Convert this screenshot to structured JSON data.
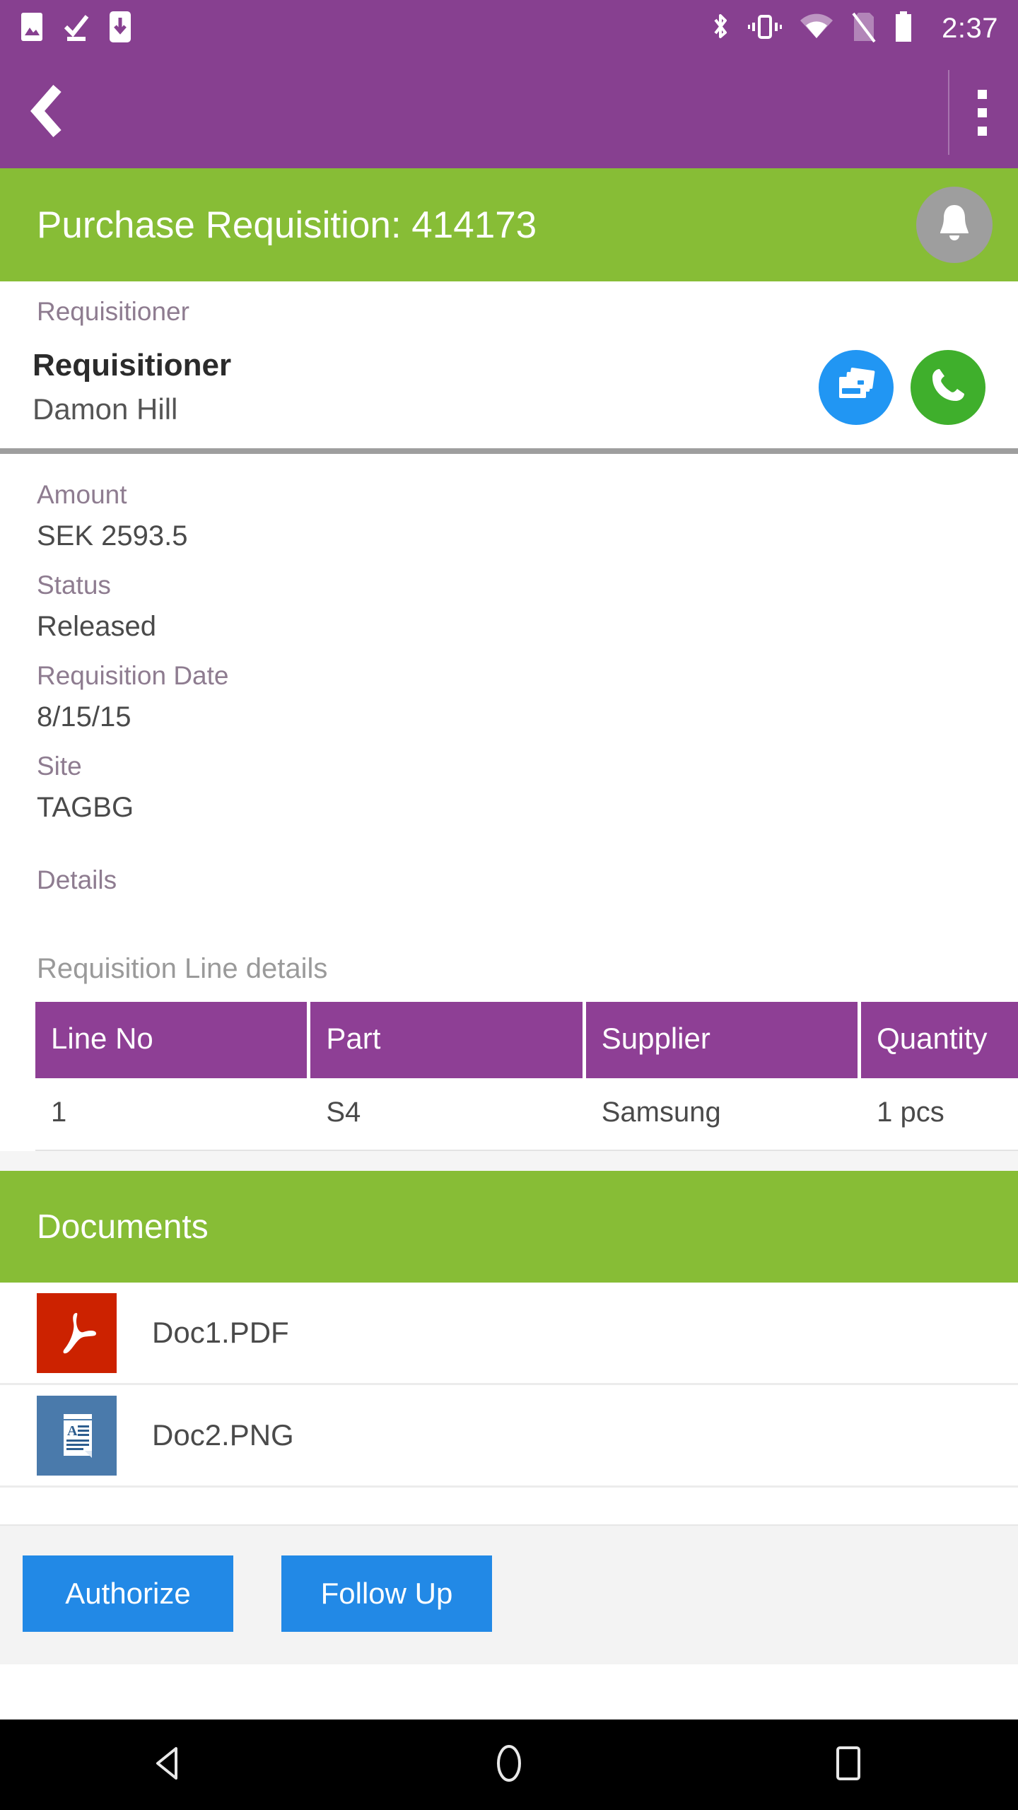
{
  "status_bar": {
    "time": "2:37",
    "left_icons": [
      "image-icon",
      "check-download-icon",
      "phone-download-icon"
    ],
    "right_icons": [
      "bluetooth-icon",
      "vibrate-icon",
      "wifi-icon",
      "no-sim-icon",
      "battery-icon"
    ]
  },
  "app_bar": {
    "back_label": "back-chevron-icon",
    "overflow_label": "overflow-menu-icon"
  },
  "title_bar": {
    "title": "Purchase Requisition: 414173",
    "bell_icon": "notification-bell-icon"
  },
  "requisitioner": {
    "section_label": "Requisitioner",
    "title": "Requisitioner",
    "name": "Damon Hill",
    "contact_card_icon": "contact-card-icon",
    "call_icon": "phone-call-icon"
  },
  "fields": [
    {
      "label": "Amount",
      "value": "SEK 2593.5"
    },
    {
      "label": "Status",
      "value": "Released"
    },
    {
      "label": "Requisition Date",
      "value": "8/15/15"
    },
    {
      "label": "Site",
      "value": "TAGBG"
    }
  ],
  "details": {
    "heading": "Details",
    "lines_heading": "Requisition Line details"
  },
  "lines_table": {
    "columns": [
      "Line No",
      "Part",
      "Supplier",
      "Quantity"
    ],
    "rows": [
      {
        "line_no": "1",
        "part": "S4",
        "supplier": "Samsung",
        "quantity": "1 pcs"
      }
    ]
  },
  "documents": {
    "header": "Documents",
    "items": [
      {
        "name": "Doc1.PDF",
        "icon": "pdf-file-icon"
      },
      {
        "name": "Doc2.PNG",
        "icon": "image-document-icon"
      }
    ]
  },
  "actions": {
    "authorize": "Authorize",
    "follow_up": "Follow Up"
  },
  "nav_bar": {
    "back": "nav-back-icon",
    "home": "nav-home-icon",
    "recents": "nav-recents-icon"
  },
  "colors": {
    "purple": "#874090",
    "green": "#87bd36",
    "table_header_purple": "#8e3f95",
    "button_blue": "#2289e6",
    "contact_blue": "#2196f3",
    "call_green": "#3faf2c",
    "pdf_red": "#cc2200",
    "png_blue": "#4a7aab"
  }
}
